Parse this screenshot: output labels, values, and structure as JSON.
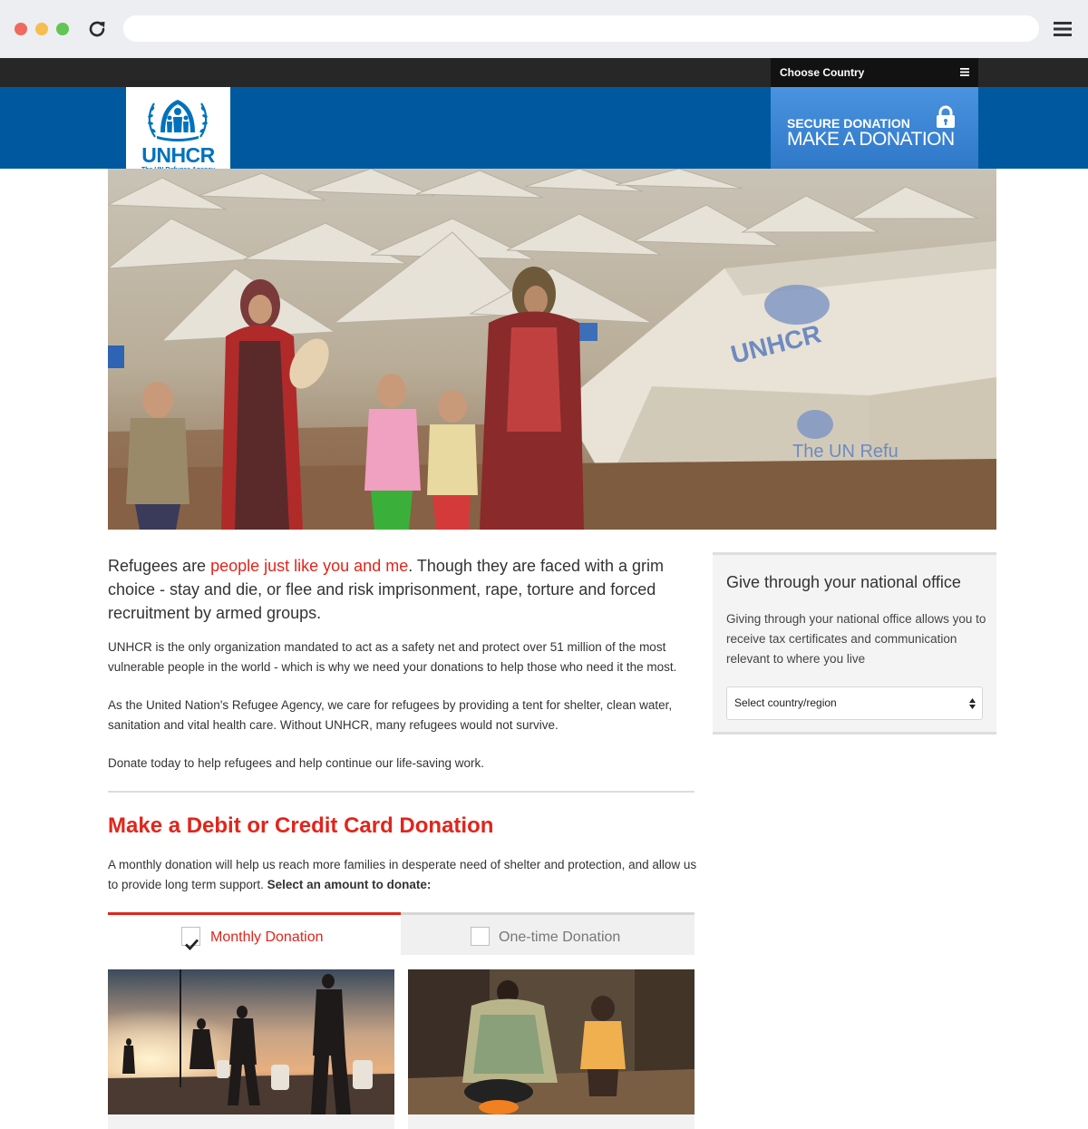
{
  "browser": {
    "url": ""
  },
  "topbar": {
    "choose_country": "Choose Country"
  },
  "header": {
    "logo_name": "UNHCR",
    "logo_tagline": "The UN Refugee Agency",
    "donate_line1": "SECURE DONATION",
    "donate_line2": "MAKE A DONATION"
  },
  "intro": {
    "lead_start": "Refugees are ",
    "lead_highlight": "people just like you and me",
    "lead_end": ". Though they are faced with a grim choice - stay and die, or flee and risk imprisonment, rape, torture and forced recruitment by armed groups.",
    "p1": "UNHCR is the only organization mandated to act as a safety net and protect over 51 million of the most vulnerable people in the world - which is why we need your donations to help those who need it the most.",
    "p2": "As the United Nation's Refugee Agency, we care for refugees by providing a tent for shelter, clean water, sanitation and vital health care. Without UNHCR, many refugees would not survive.",
    "p3": "Donate today to help refugees and help continue our life-saving work."
  },
  "donation": {
    "title": "Make a Debit or Credit Card Donation",
    "text": "A monthly donation will help us reach more families in desperate need of shelter and protection, and allow us to provide long term support. ",
    "text_bold": "Select an amount to donate:",
    "tabs": [
      {
        "label": "Monthly Donation",
        "checked": true
      },
      {
        "label": "One-time Donation",
        "checked": false
      }
    ]
  },
  "sidebar": {
    "title": "Give through your national office",
    "text": "Giving through your national office allows you to receive tax certificates and communication relevant to where you live",
    "select_value": "Select country/region"
  },
  "colors": {
    "brand_blue": "#00599f",
    "accent_red": "#e1251b",
    "donate_blue": "#3f89d8"
  }
}
